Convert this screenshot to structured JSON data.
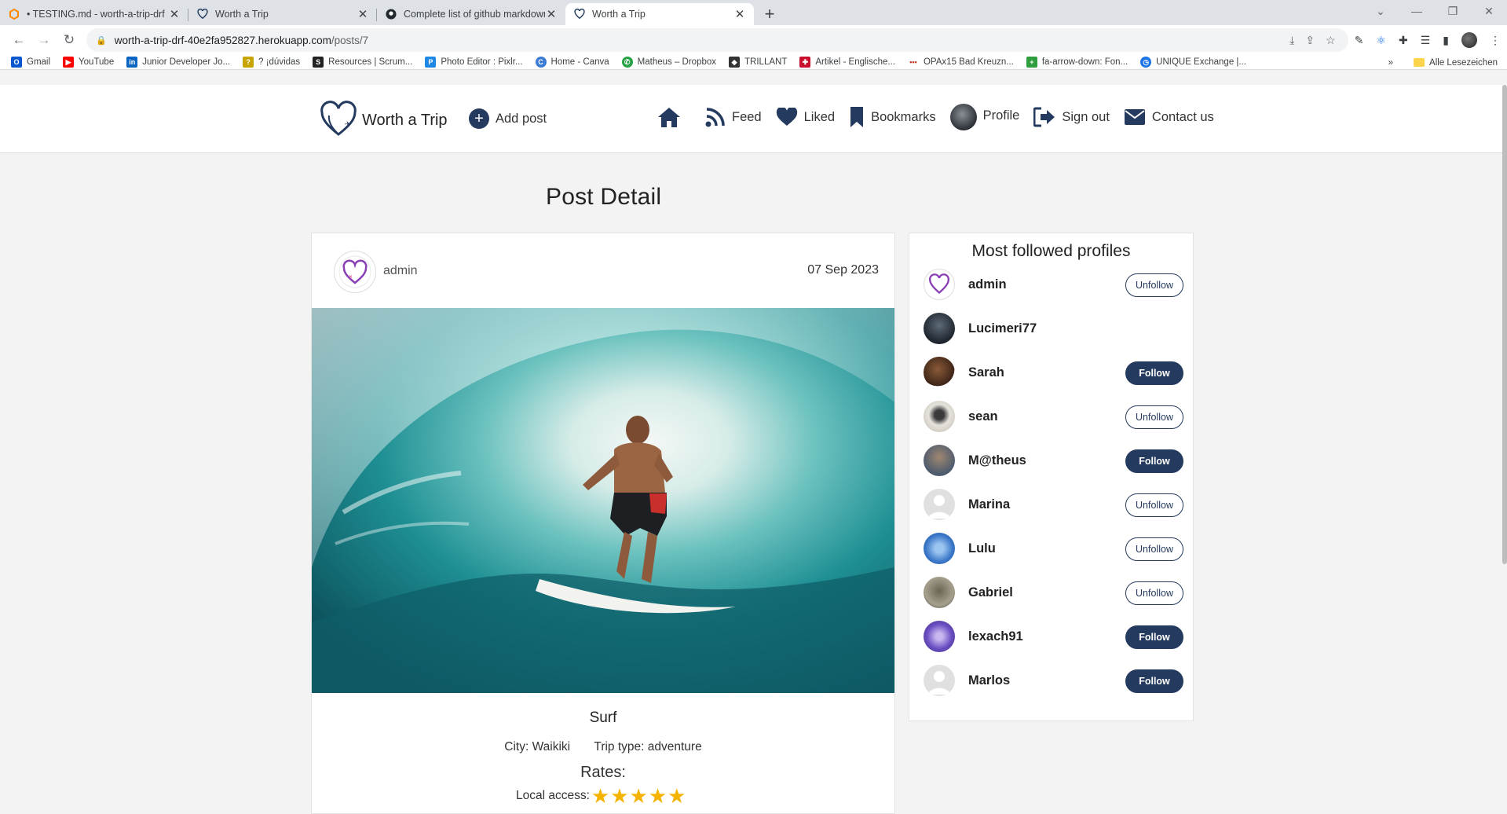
{
  "browser": {
    "tabs": [
      {
        "title": "• TESTING.md - worth-a-trip-drf",
        "icon": "gitpod-icon"
      },
      {
        "title": "Worth a Trip",
        "icon": "heart-logo-icon"
      },
      {
        "title": "Complete list of github markdown",
        "icon": "github-icon"
      },
      {
        "title": "Worth a Trip",
        "icon": "heart-logo-icon",
        "active": true
      }
    ],
    "url_host": "worth-a-trip-drf-40e2fa952827.herokuapp.com",
    "url_path": "/posts/7",
    "bookmarks": [
      {
        "label": "Gmail",
        "color": "#0b57d0"
      },
      {
        "label": "YouTube",
        "color": "#ff0000"
      },
      {
        "label": "Junior Developer Jo...",
        "color": "#0a66c2"
      },
      {
        "label": "? ¡dúvidas",
        "color": "#c8a400"
      },
      {
        "label": "Resources | Scrum...",
        "color": "#222222"
      },
      {
        "label": "Photo Editor : Pixlr...",
        "color": "#1e88e5"
      },
      {
        "label": "Home - Canva",
        "color": "#3a7bd5"
      },
      {
        "label": "Matheus – Dropbox",
        "color": "#25a244"
      },
      {
        "label": "TRILLANT",
        "color": "#333333"
      },
      {
        "label": "Artikel - Englische...",
        "color": "#c8102e"
      },
      {
        "label": "OPAx15 Bad Kreuzn...",
        "color": "#c0392b"
      },
      {
        "label": "fa-arrow-down: Fon...",
        "color": "#2e9e3e"
      },
      {
        "label": "UNIQUE Exchange |...",
        "color": "#1a73e8"
      }
    ],
    "bookmarks_more": "»",
    "all_bookmarks": "Alle Lesezeichen"
  },
  "nav": {
    "brand": "Worth a Trip",
    "add_post": "Add post",
    "feed": "Feed",
    "liked": "Liked",
    "bookmarks": "Bookmarks",
    "profile": "Profile",
    "sign_out": "Sign out",
    "contact": "Contact us"
  },
  "page": {
    "title": "Post Detail"
  },
  "post": {
    "author": "admin",
    "date": "07 Sep 2023",
    "title": "Surf",
    "city": "City: Waikiki",
    "trip_type": "Trip type: adventure",
    "rates_label": "Rates:",
    "local_access_label": "Local access:",
    "local_access_stars": 5
  },
  "sidebar": {
    "title": "Most followed profiles",
    "profiles": [
      {
        "name": "admin",
        "button": "Unfollow"
      },
      {
        "name": "Lucimeri77",
        "button": ""
      },
      {
        "name": "Sarah",
        "button": "Follow"
      },
      {
        "name": "sean",
        "button": "Unfollow"
      },
      {
        "name": "M@theus",
        "button": "Follow"
      },
      {
        "name": "Marina",
        "button": "Unfollow"
      },
      {
        "name": "Lulu",
        "button": "Unfollow"
      },
      {
        "name": "Gabriel",
        "button": "Unfollow"
      },
      {
        "name": "lexach91",
        "button": "Follow"
      },
      {
        "name": "Marlos",
        "button": "Follow"
      }
    ]
  },
  "colors": {
    "brand_navy": "#243a5e",
    "star": "#f5b301",
    "page_bg": "#f3f3f3"
  }
}
